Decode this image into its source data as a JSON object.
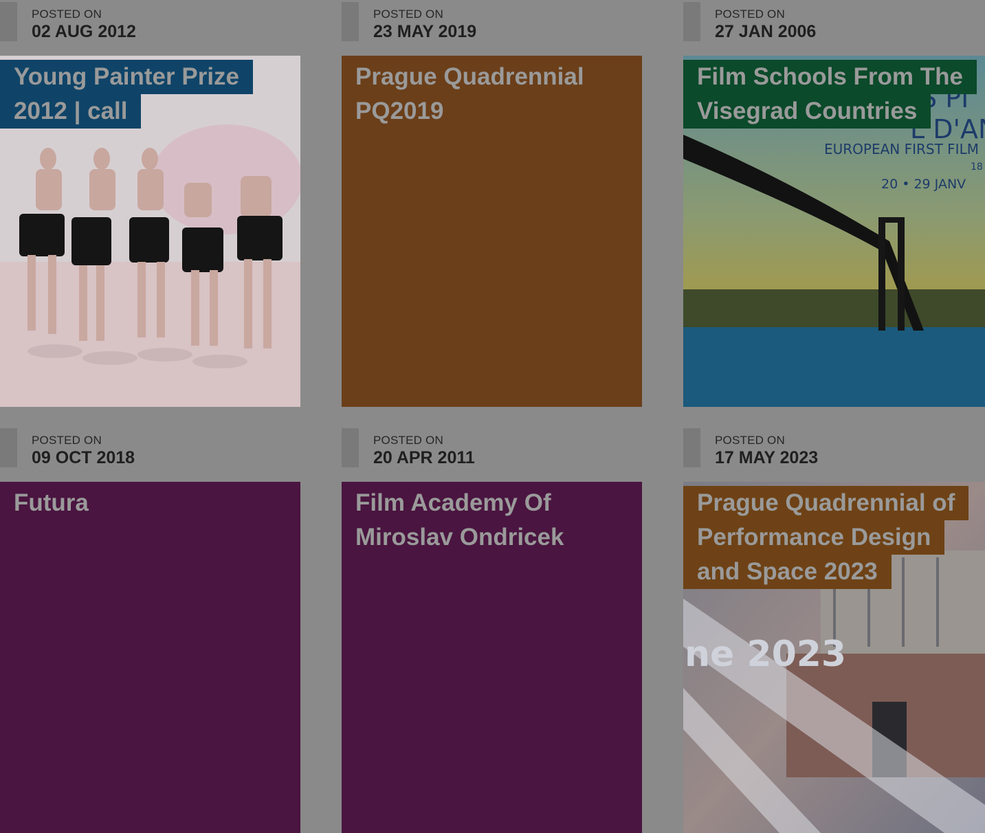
{
  "posted_label": "POSTED ON",
  "posts": [
    {
      "date": "02 AUG 2012",
      "title_lines": [
        "Young Painter Prize",
        "2012 | call"
      ],
      "title_bg": "#0f4468",
      "thumb": "painting-bathers"
    },
    {
      "date": "23 MAY 2019",
      "title_lines": [
        "Prague Quadrennial",
        "PQ2019"
      ],
      "title_bg": "",
      "bg": "#6b3f1a"
    },
    {
      "date": "27 JAN 2006",
      "title_lines": [
        "Film Schools From The",
        "Visegrad Countries"
      ],
      "title_bg": "#0b4a2a",
      "thumb": "bridge-poster",
      "poster_text": [
        "S PI",
        "L D'AN",
        "EUROPEAN FIRST FILM",
        "18",
        "20 • 29 JANV"
      ]
    },
    {
      "date": "09 OCT 2018",
      "title_lines": [
        "Futura"
      ],
      "title_bg": "",
      "bg": "#4a1540"
    },
    {
      "date": "20 APR 2011",
      "title_lines": [
        "Film Academy Of",
        "Miroslav Ondricek"
      ],
      "title_bg": "",
      "bg": "#4a1540"
    },
    {
      "date": "17 MAY 2023",
      "title_lines": [
        "Prague Quadrennial of",
        "Performance Design",
        "and Space 2023"
      ],
      "title_bg": "#6e4216",
      "thumb": "pq-poster",
      "poster_text": "ne 2023"
    }
  ]
}
